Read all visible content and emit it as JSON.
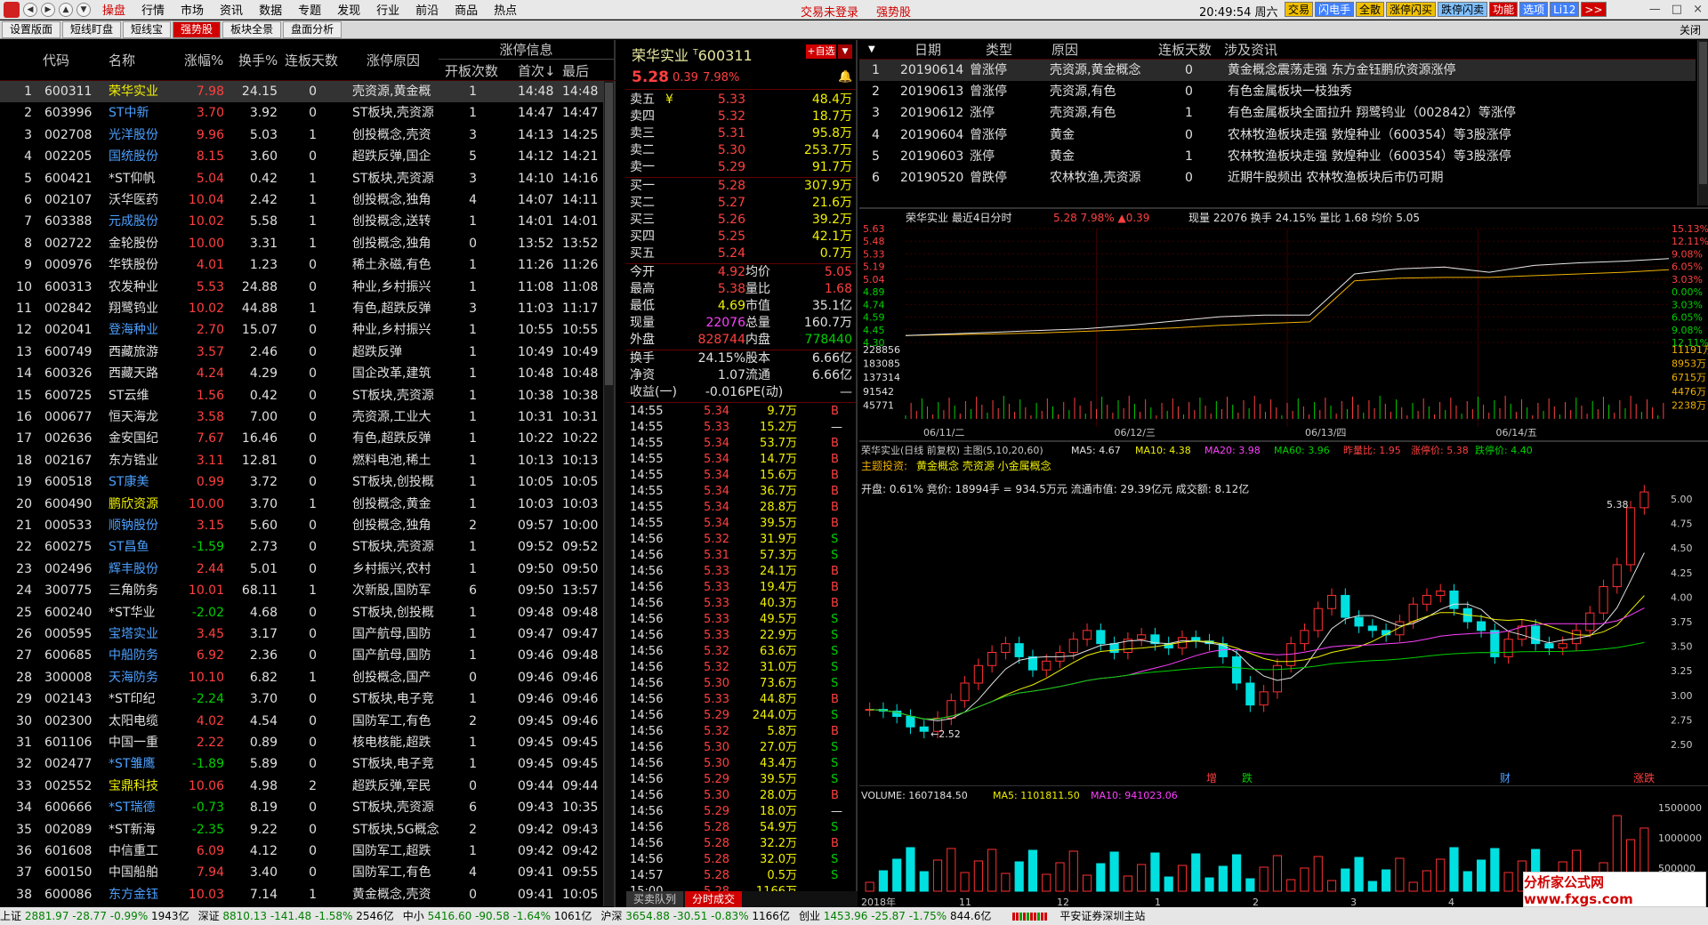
{
  "menu": {
    "items": [
      "行情",
      "市场",
      "资讯",
      "数据",
      "专题",
      "发现",
      "行业",
      "前沿",
      "商品",
      "热点"
    ],
    "active_label": "操盘",
    "center": [
      "交易未登录",
      "强势股"
    ],
    "clock": "20:49:54",
    "weekday": "周六",
    "toolbar": [
      "交易",
      "闪电手",
      "全散",
      "涨停闪买",
      "跌停闪卖",
      "功能",
      "选项",
      "Li12",
      ">>"
    ],
    "win": [
      "—",
      "□",
      "×"
    ]
  },
  "tabs": {
    "items": [
      "设置版面",
      "短线盯盘",
      "短线宝",
      "强势股",
      "板块全景",
      "盘面分析"
    ],
    "active": 3,
    "close": "关闭"
  },
  "limit_table": {
    "headers": {
      "code": "代码",
      "name": "名称",
      "chg": "涨幅%",
      "turnover": "换手%",
      "streak": "连板天数",
      "reason": "涨停原因",
      "group": "涨停信息",
      "open_count": "开板次数",
      "first": "首次↓",
      "last": "最后"
    },
    "rows": [
      [
        "1",
        "600311",
        "荣华实业",
        "7.98",
        "24.15",
        "0",
        "壳资源,黄金概",
        "1",
        "14:48",
        "14:48",
        "y",
        "r"
      ],
      [
        "2",
        "603996",
        "ST中新",
        "3.70",
        "3.92",
        "0",
        "ST板块,壳资源",
        "1",
        "14:47",
        "14:47",
        "b",
        "r"
      ],
      [
        "3",
        "002708",
        "光洋股份",
        "9.96",
        "5.03",
        "1",
        "创投概念,壳资",
        "3",
        "14:13",
        "14:25",
        "b",
        "r"
      ],
      [
        "4",
        "002205",
        "国统股份",
        "8.15",
        "3.60",
        "0",
        "超跌反弹,国企",
        "5",
        "14:12",
        "14:21",
        "b",
        "r"
      ],
      [
        "5",
        "600421",
        "*ST仰帆",
        "5.04",
        "0.42",
        "1",
        "ST板块,壳资源",
        "3",
        "14:10",
        "14:16",
        "w",
        "r"
      ],
      [
        "6",
        "002107",
        "沃华医药",
        "10.04",
        "2.42",
        "1",
        "创投概念,独角",
        "4",
        "14:07",
        "14:11",
        "w",
        "r"
      ],
      [
        "7",
        "603388",
        "元成股份",
        "10.02",
        "5.58",
        "1",
        "创投概念,送转",
        "1",
        "14:01",
        "14:01",
        "b",
        "r"
      ],
      [
        "8",
        "002722",
        "金轮股份",
        "10.00",
        "3.31",
        "1",
        "创投概念,独角",
        "0",
        "13:52",
        "13:52",
        "w",
        "r"
      ],
      [
        "9",
        "000976",
        "华铁股份",
        "4.01",
        "1.23",
        "0",
        "稀土永磁,有色",
        "1",
        "11:26",
        "11:26",
        "w",
        "r"
      ],
      [
        "10",
        "600313",
        "农发种业",
        "5.53",
        "24.88",
        "0",
        "种业,乡村振兴",
        "1",
        "11:08",
        "11:08",
        "w",
        "r"
      ],
      [
        "11",
        "002842",
        "翔鹭钨业",
        "10.02",
        "44.88",
        "1",
        "有色,超跌反弹",
        "3",
        "11:03",
        "11:17",
        "w",
        "r"
      ],
      [
        "12",
        "002041",
        "登海种业",
        "2.70",
        "15.07",
        "0",
        "种业,乡村振兴",
        "1",
        "10:55",
        "10:55",
        "b",
        "r"
      ],
      [
        "13",
        "600749",
        "西藏旅游",
        "3.57",
        "2.46",
        "0",
        "超跌反弹",
        "1",
        "10:49",
        "10:49",
        "w",
        "r"
      ],
      [
        "14",
        "600326",
        "西藏天路",
        "4.24",
        "4.29",
        "0",
        "国企改革,建筑",
        "1",
        "10:48",
        "10:48",
        "w",
        "r"
      ],
      [
        "15",
        "600725",
        "ST云维",
        "1.56",
        "0.42",
        "0",
        "ST板块,壳资源",
        "1",
        "10:38",
        "10:38",
        "w",
        "r"
      ],
      [
        "16",
        "000677",
        "恒天海龙",
        "3.58",
        "7.00",
        "0",
        "壳资源,工业大",
        "1",
        "10:31",
        "10:31",
        "w",
        "r"
      ],
      [
        "17",
        "002636",
        "金安国纪",
        "7.67",
        "16.46",
        "0",
        "有色,超跌反弹",
        "1",
        "10:22",
        "10:22",
        "w",
        "r"
      ],
      [
        "18",
        "002167",
        "东方锆业",
        "3.11",
        "12.81",
        "0",
        "燃料电池,稀土",
        "1",
        "10:13",
        "10:13",
        "w",
        "r"
      ],
      [
        "19",
        "600518",
        "ST康美",
        "0.99",
        "3.72",
        "0",
        "ST板块,创投概",
        "1",
        "10:05",
        "10:05",
        "b",
        "r"
      ],
      [
        "20",
        "600490",
        "鹏欣资源",
        "10.00",
        "3.70",
        "1",
        "创投概念,黄金",
        "1",
        "10:03",
        "10:03",
        "y",
        "r"
      ],
      [
        "21",
        "000533",
        "顺钠股份",
        "3.15",
        "5.60",
        "0",
        "创投概念,独角",
        "2",
        "09:57",
        "10:00",
        "b",
        "r"
      ],
      [
        "22",
        "600275",
        "ST昌鱼",
        "-1.59",
        "2.73",
        "0",
        "ST板块,壳资源",
        "1",
        "09:52",
        "09:52",
        "b",
        "g"
      ],
      [
        "23",
        "002496",
        "辉丰股份",
        "2.44",
        "5.01",
        "0",
        "乡村振兴,农村",
        "1",
        "09:50",
        "09:50",
        "b",
        "r"
      ],
      [
        "24",
        "300775",
        "三角防务",
        "10.01",
        "68.11",
        "1",
        "次新股,国防军",
        "6",
        "09:50",
        "13:57",
        "w",
        "r"
      ],
      [
        "25",
        "600240",
        "*ST华业",
        "-2.02",
        "4.68",
        "0",
        "ST板块,创投概",
        "1",
        "09:48",
        "09:48",
        "w",
        "g"
      ],
      [
        "26",
        "000595",
        "宝塔实业",
        "3.45",
        "3.17",
        "0",
        "国产航母,国防",
        "1",
        "09:47",
        "09:47",
        "b",
        "r"
      ],
      [
        "27",
        "600685",
        "中船防务",
        "6.92",
        "2.36",
        "0",
        "国产航母,国防",
        "1",
        "09:46",
        "09:48",
        "b",
        "r"
      ],
      [
        "28",
        "300008",
        "天海防务",
        "10.10",
        "6.82",
        "1",
        "创投概念,国产",
        "0",
        "09:46",
        "09:46",
        "b",
        "r"
      ],
      [
        "29",
        "002143",
        "*ST印纪",
        "-2.24",
        "3.70",
        "0",
        "ST板块,电子竞",
        "1",
        "09:46",
        "09:46",
        "w",
        "g"
      ],
      [
        "30",
        "002300",
        "太阳电缆",
        "4.02",
        "4.54",
        "0",
        "国防军工,有色",
        "2",
        "09:45",
        "09:46",
        "w",
        "r"
      ],
      [
        "31",
        "601106",
        "中国一重",
        "2.22",
        "0.89",
        "0",
        "核电核能,超跌",
        "1",
        "09:45",
        "09:45",
        "w",
        "r"
      ],
      [
        "32",
        "002477",
        "*ST雏鹰",
        "-1.89",
        "5.89",
        "0",
        "ST板块,电子竞",
        "1",
        "09:45",
        "09:45",
        "b",
        "g"
      ],
      [
        "33",
        "002552",
        "宝鼎科技",
        "10.06",
        "4.98",
        "2",
        "超跌反弹,军民",
        "0",
        "09:44",
        "09:44",
        "y",
        "r"
      ],
      [
        "34",
        "600666",
        "*ST瑞德",
        "-0.73",
        "8.19",
        "0",
        "ST板块,壳资源",
        "6",
        "09:43",
        "10:35",
        "b",
        "g"
      ],
      [
        "35",
        "002089",
        "*ST新海",
        "-2.35",
        "9.22",
        "0",
        "ST板块,5G概念",
        "2",
        "09:42",
        "09:43",
        "w",
        "g"
      ],
      [
        "36",
        "601608",
        "中信重工",
        "6.09",
        "4.12",
        "0",
        "国防军工,超跌",
        "1",
        "09:42",
        "09:42",
        "w",
        "r"
      ],
      [
        "37",
        "600150",
        "中国船舶",
        "7.94",
        "3.40",
        "0",
        "国防军工,有色",
        "4",
        "09:41",
        "09:55",
        "w",
        "r"
      ],
      [
        "38",
        "600086",
        "东方金钰",
        "10.03",
        "7.14",
        "1",
        "黄金概念,壳资",
        "0",
        "09:41",
        "10:05",
        "b",
        "r"
      ]
    ]
  },
  "quote": {
    "title": "荣华实业",
    "code": "600311",
    "code_mark": "T",
    "add_label": "+自选",
    "price": "5.28",
    "change": "0.39",
    "pct": "7.98%",
    "asks": [
      [
        "卖五",
        "¥",
        "5.33",
        "48.4万"
      ],
      [
        "卖四",
        "",
        "5.32",
        "18.7万"
      ],
      [
        "卖三",
        "",
        "5.31",
        "95.8万"
      ],
      [
        "卖二",
        "",
        "5.30",
        "253.7万"
      ],
      [
        "卖一",
        "",
        "5.29",
        "91.7万"
      ]
    ],
    "bids": [
      [
        "买一",
        "5.28",
        "307.9万"
      ],
      [
        "买二",
        "5.27",
        "21.6万"
      ],
      [
        "买三",
        "5.26",
        "39.2万"
      ],
      [
        "买四",
        "5.25",
        "42.1万"
      ],
      [
        "买五",
        "5.24",
        "0.7万"
      ]
    ],
    "stats": [
      [
        "今开",
        "4.92",
        "r",
        "均价",
        "5.05",
        "r"
      ],
      [
        "最高",
        "5.38",
        "r",
        "量比",
        "1.68",
        "r"
      ],
      [
        "最低",
        "4.69",
        "y",
        "市值",
        "35.1亿",
        "w"
      ],
      [
        "现量",
        "22076",
        "m",
        "总量",
        "160.7万",
        "w"
      ],
      [
        "外盘",
        "828744",
        "r",
        "内盘",
        "778440",
        "g"
      ]
    ],
    "stats2": [
      [
        "换手",
        "24.15%",
        "股本",
        "6.66亿"
      ],
      [
        "净资",
        "1.07",
        "流通",
        "6.66亿"
      ],
      [
        "收益(一)",
        "-0.016",
        "PE(动)",
        "—"
      ]
    ],
    "trades": [
      [
        "14:55",
        "5.34",
        "9.7万",
        "B"
      ],
      [
        "14:55",
        "5.33",
        "15.2万",
        ""
      ],
      [
        "14:55",
        "5.34",
        "53.7万",
        "B"
      ],
      [
        "14:55",
        "5.34",
        "14.7万",
        "B"
      ],
      [
        "14:55",
        "5.34",
        "15.6万",
        "B"
      ],
      [
        "14:55",
        "5.34",
        "36.7万",
        "B"
      ],
      [
        "14:55",
        "5.34",
        "28.8万",
        "B"
      ],
      [
        "14:55",
        "5.34",
        "39.5万",
        "B"
      ],
      [
        "14:56",
        "5.32",
        "31.9万",
        "S"
      ],
      [
        "14:56",
        "5.31",
        "57.3万",
        "S"
      ],
      [
        "14:56",
        "5.33",
        "24.1万",
        "B"
      ],
      [
        "14:56",
        "5.33",
        "19.4万",
        "B"
      ],
      [
        "14:56",
        "5.33",
        "40.3万",
        "B"
      ],
      [
        "14:56",
        "5.33",
        "49.5万",
        "S"
      ],
      [
        "14:56",
        "5.33",
        "22.9万",
        "S"
      ],
      [
        "14:56",
        "5.32",
        "63.6万",
        "S"
      ],
      [
        "14:56",
        "5.32",
        "31.0万",
        "S"
      ],
      [
        "14:56",
        "5.30",
        "73.6万",
        "S"
      ],
      [
        "14:56",
        "5.33",
        "44.8万",
        "B"
      ],
      [
        "14:56",
        "5.29",
        "244.0万",
        "S"
      ],
      [
        "14:56",
        "5.32",
        "5.8万",
        "B"
      ],
      [
        "14:56",
        "5.30",
        "27.0万",
        "S"
      ],
      [
        "14:56",
        "5.30",
        "43.4万",
        "S"
      ],
      [
        "14:56",
        "5.29",
        "39.5万",
        "S"
      ],
      [
        "14:56",
        "5.30",
        "28.0万",
        "B"
      ],
      [
        "14:56",
        "5.29",
        "18.0万",
        ""
      ],
      [
        "14:56",
        "5.28",
        "54.9万",
        "S"
      ],
      [
        "14:56",
        "5.28",
        "32.2万",
        "B"
      ],
      [
        "14:56",
        "5.28",
        "32.0万",
        "S"
      ],
      [
        "14:57",
        "5.28",
        "0.5万",
        "S"
      ],
      [
        "15:00",
        "5.28",
        "1166万",
        ""
      ]
    ],
    "tabs": [
      "买卖队列",
      "分时成交"
    ]
  },
  "history": {
    "headers": [
      "日期",
      "类型",
      "原因",
      "连板天数",
      "涉及资讯"
    ],
    "rows": [
      [
        "1",
        "20190614",
        "曾涨停",
        "壳资源,黄金概念",
        "0",
        "黄金概念震荡走强 东方金钰鹏欣资源涨停"
      ],
      [
        "2",
        "20190613",
        "曾涨停",
        "壳资源,有色",
        "0",
        "有色金属板块一枝独秀"
      ],
      [
        "3",
        "20190612",
        "涨停",
        "壳资源,有色",
        "1",
        "有色金属板块全面拉升 翔鹭钨业（002842）等涨停"
      ],
      [
        "4",
        "20190604",
        "曾涨停",
        "黄金",
        "0",
        "农林牧渔板块走强 敦煌种业（600354）等3股涨停"
      ],
      [
        "5",
        "20190603",
        "涨停",
        "黄金",
        "1",
        "农林牧渔板块走强 敦煌种业（600354）等3股涨停"
      ],
      [
        "6",
        "20190520",
        "曾跌停",
        "农林牧渔,壳资源",
        "0",
        "近期牛股频出 农林牧渔板块后市仍可期"
      ]
    ]
  },
  "intraday": {
    "title": "荣华实业",
    "label": "最近4日分时",
    "price": "5.28",
    "pct": "7.98%",
    "change": "▲0.39",
    "vol_label": "现量",
    "vol": "22076",
    "turn_label": "换手",
    "turn": "24.15%",
    "ratio_label": "量比",
    "ratio": "1.68",
    "avg_label": "均价",
    "avg": "5.05",
    "left_ticks": [
      "5.63",
      "5.48",
      "5.33",
      "5.19",
      "5.04",
      "4.89",
      "4.74",
      "4.59",
      "4.45",
      "4.30"
    ],
    "right_ticks": [
      "15.13%",
      "12.11%",
      "9.08%",
      "6.05%",
      "3.03%",
      "0.00%",
      "3.03%",
      "6.05%",
      "9.08%",
      "12.11%"
    ],
    "vol_ticks_left": [
      "228856",
      "183085",
      "137314",
      "91542",
      "45771"
    ],
    "vol_ticks_right": [
      "11191万",
      "8953万",
      "6715万",
      "4476万",
      "2238万"
    ],
    "dates": [
      "06/11/二",
      "06/12/三",
      "06/13/四",
      "06/14/五"
    ],
    "chart_data": {
      "type": "line",
      "series": [
        {
          "name": "价格",
          "values": [
            4.38,
            4.4,
            4.42,
            4.44,
            4.46,
            4.5,
            4.55,
            4.6,
            4.62,
            4.62,
            5.1,
            5.16,
            5.18,
            5.12,
            5.2,
            5.23,
            5.25,
            5.28
          ]
        },
        {
          "name": "均价",
          "values": [
            4.38,
            4.39,
            4.4,
            4.41,
            4.43,
            4.45,
            4.47,
            4.5,
            4.52,
            4.54,
            5.02,
            5.05,
            5.06,
            5.06,
            5.08,
            5.1,
            5.12,
            5.15
          ]
        }
      ],
      "ylim": [
        4.3,
        5.63
      ]
    }
  },
  "kline": {
    "title": "荣华实业(日线 前复权)",
    "main": "主图(5,10,20,60)",
    "ma5": "MA5: 4.67",
    "ma10": "MA10: 4.38",
    "ma20": "MA20: 3.98",
    "ma60": "MA60: 3.96",
    "prev_close": "昨量比: 1.95",
    "limit_up": "涨停价: 5.38",
    "limit_down": "跌停价: 4.40",
    "theme_label": "主题投资:",
    "theme": "黄金概念 壳资源 小金属概念",
    "info": "开盘: 0.61%      竞价: 18994手 = 934.5万元      流通市值: 29.39亿元      成交额: 8.12亿",
    "ticks": [
      "5.00",
      "4.75",
      "4.50",
      "4.25",
      "4.00",
      "3.75",
      "3.50",
      "3.25",
      "3.00",
      "2.75",
      "2.50"
    ],
    "high_mark": "5.38",
    "low_mark": "←2.52",
    "flags": [
      "增",
      "跌",
      "财",
      "涨跌"
    ],
    "vol_title": "VOLUME: 1607184.50",
    "vol_ma5": "MA5: 1101811.50",
    "vol_ma10": "MA10: 941023.06",
    "vol_ticks": [
      "1500000",
      "1000000",
      "500000"
    ],
    "x_labels": [
      "2018年",
      "11",
      "12",
      "1",
      "2",
      "3",
      "4",
      "5"
    ],
    "chart_data": {
      "type": "candlestick",
      "closes": [
        2.8,
        2.78,
        2.72,
        2.6,
        2.55,
        2.7,
        2.9,
        3.1,
        3.3,
        3.45,
        3.55,
        3.4,
        3.25,
        3.35,
        3.45,
        3.6,
        3.7,
        3.55,
        3.45,
        3.6,
        3.65,
        3.55,
        3.5,
        3.62,
        3.58,
        3.55,
        3.4,
        3.1,
        2.85,
        3.0,
        3.3,
        3.55,
        3.7,
        3.95,
        4.1,
        3.85,
        3.75,
        3.7,
        3.65,
        3.8,
        4.0,
        4.1,
        4.15,
        3.95,
        3.8,
        3.7,
        3.4,
        3.6,
        3.75,
        3.55,
        3.5,
        3.55,
        3.7,
        3.9,
        4.2,
        4.45,
        5.1,
        5.28
      ],
      "ylim": [
        2.4,
        5.2
      ]
    }
  },
  "status": [
    [
      "上证",
      "2881.97",
      "-28.77",
      "-0.99%",
      "1943亿"
    ],
    [
      "深证",
      "8810.13",
      "-141.48",
      "-1.58%",
      "2546亿"
    ],
    [
      "中小",
      "5416.60",
      "-90.58",
      "-1.64%",
      "1061亿"
    ],
    [
      "沪深",
      "3654.88",
      "-30.51",
      "-0.83%",
      "1166亿"
    ],
    [
      "创业",
      "1453.96",
      "-25.87",
      "-1.75%",
      "844.6亿"
    ]
  ],
  "broker": "平安证券深圳主站",
  "watermark": "分析家公式网 www.fxgs.com"
}
